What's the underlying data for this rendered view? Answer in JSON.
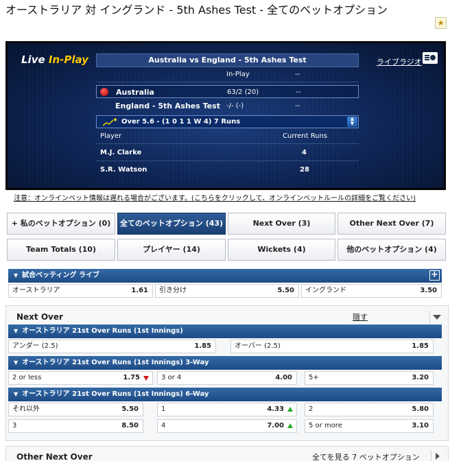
{
  "page": {
    "title": "オーストラリア 対 イングランド - 5th Ashes Test - 全てのベットオプション",
    "favourite_icon": "star-icon"
  },
  "live": {
    "logo_text_1": "Live",
    "logo_text_2": "In-Play",
    "radio_link": "ライブラジオ",
    "radio_icon": "radio-icon",
    "match_title": "Australia vs England - 5th Ashes Test",
    "inplay_label": "In-Play",
    "inplay_value": "--",
    "team1": {
      "name": "Australia",
      "score": "63/2 (20)",
      "extra": "--"
    },
    "team2": {
      "name": "England - 5th Ashes Test",
      "score": "-/- (-)",
      "extra": "--"
    },
    "over_text": "Over 5.6 - (1 0 1 1 W 4) 7 Runs",
    "player_header": "Player",
    "runs_header": "Current Runs",
    "players": [
      {
        "name": "M.J. Clarke",
        "runs": "4"
      },
      {
        "name": "S.R. Watson",
        "runs": "28"
      }
    ]
  },
  "notice": "注意：オンラインベット情報は遅れる場合がございます。(こちらをクリックして、オンラインベットルールの詳細をご覧ください)",
  "tabs": [
    {
      "label": "+ 私のベットオプション (0)"
    },
    {
      "label": "全てのベットオプション (43)"
    },
    {
      "label": "Next Over (3)"
    },
    {
      "label": "Other Next Over (7)"
    },
    {
      "label": "Team Totals (10)"
    },
    {
      "label": "プレイヤー (14)"
    },
    {
      "label": "Wickets (4)"
    },
    {
      "label": "他のベットオプション (4)"
    }
  ],
  "match_betting": {
    "title": "試合ベッティング ライブ",
    "cells": [
      {
        "label": "オーストラリア",
        "odds": "1.61"
      },
      {
        "label": "引き分け",
        "odds": "5.50"
      },
      {
        "label": "イングランド",
        "odds": "3.50"
      }
    ]
  },
  "next_over": {
    "title": "Next Over",
    "hide_link": "隠す",
    "markets": [
      {
        "title": "オーストラリア 21st Over Runs (1st Innings)",
        "cells": [
          {
            "label": "アンダー (2.5)",
            "odds": "1.85"
          },
          {
            "label": "オーバー (2.5)",
            "odds": "1.85"
          }
        ]
      },
      {
        "title": "オーストラリア 21st Over Runs (1st Innings) 3-Way",
        "cells": [
          {
            "label": "2 or less",
            "odds": "1.75",
            "trend": "down"
          },
          {
            "label": "3 or 4",
            "odds": "4.00"
          },
          {
            "label": "5+",
            "odds": "3.20"
          }
        ]
      },
      {
        "title": "オーストラリア 21st Over Runs (1st Innings) 6-Way",
        "cells": [
          {
            "label": "それ以外",
            "odds": "5.50"
          },
          {
            "label": "1",
            "odds": "4.33",
            "trend": "up"
          },
          {
            "label": "2",
            "odds": "5.80"
          },
          {
            "label": "3",
            "odds": "8.50"
          },
          {
            "label": "4",
            "odds": "7.00",
            "trend": "up"
          },
          {
            "label": "5 or more",
            "odds": "3.10"
          }
        ]
      }
    ]
  },
  "other_next_over": {
    "title": "Other Next Over",
    "more_link": "全てを見る 7 ベットオプション"
  }
}
